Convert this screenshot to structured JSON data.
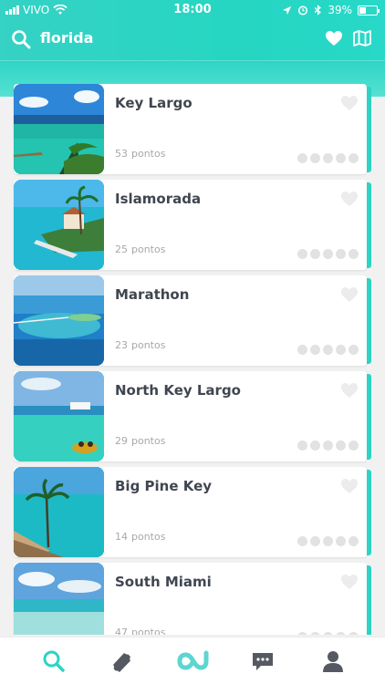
{
  "status": {
    "carrier": "VIVO",
    "time": "18:00",
    "battery": "39%",
    "battery_level": 0.39
  },
  "header": {
    "search_term": "florida"
  },
  "places": [
    {
      "name": "Key Largo",
      "points": "53",
      "unit": "pontos",
      "thumb": "beach-palms"
    },
    {
      "name": "Islamorada",
      "points": "25",
      "unit": "pontos",
      "thumb": "island-resort"
    },
    {
      "name": "Marathon",
      "points": "23",
      "unit": "pontos",
      "thumb": "bridge-sea"
    },
    {
      "name": "North Key Largo",
      "points": "29",
      "unit": "pontos",
      "thumb": "turquoise-boat"
    },
    {
      "name": "Big Pine Key",
      "points": "14",
      "unit": "pontos",
      "thumb": "palm-shore"
    },
    {
      "name": "South Miami",
      "points": "47",
      "unit": "pontos",
      "thumb": "sky-beach"
    }
  ],
  "rating_dots": 5,
  "colors": {
    "accent": "#2dd3c4",
    "title": "#3f4651",
    "muted": "#a8a8a8"
  },
  "tabbar": {
    "active": "search"
  }
}
